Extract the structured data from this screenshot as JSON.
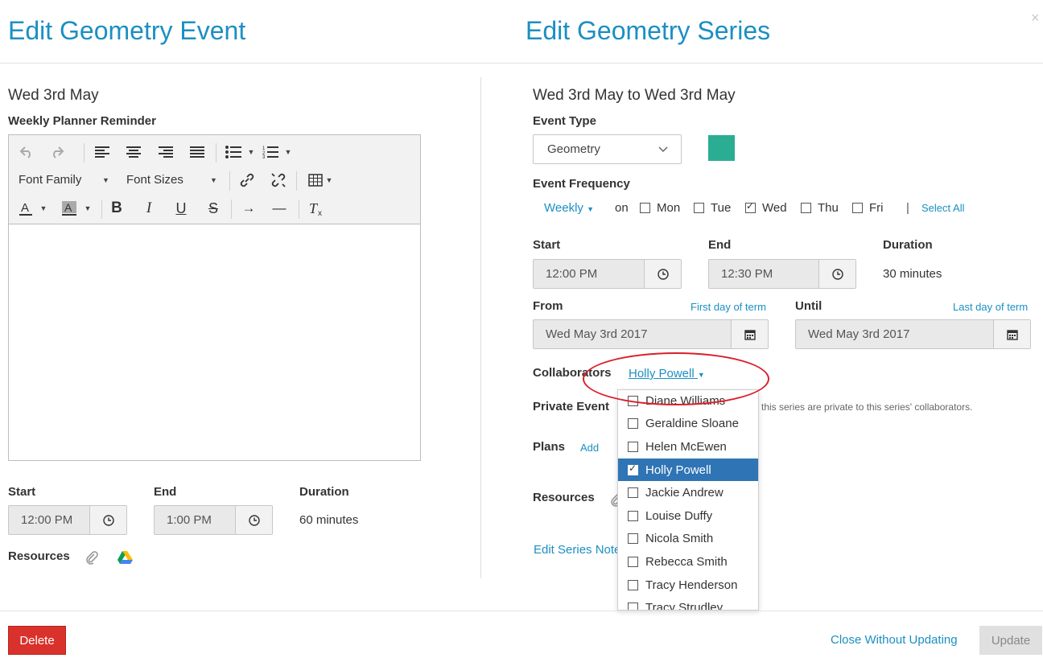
{
  "colors": {
    "accent": "#1b8fc2",
    "delete": "#d9312b",
    "event_type_swatch": "#2bad94",
    "selected_row": "#2f74b5",
    "annotation": "#d9202a"
  },
  "left": {
    "title": "Edit Geometry Event",
    "date": "Wed 3rd May",
    "reminder_label": "Weekly Planner Reminder",
    "toolbar": {
      "font_family": "Font Family",
      "font_sizes": "Font Sizes"
    },
    "start_label": "Start",
    "start_value": "12:00 PM",
    "end_label": "End",
    "end_value": "1:00 PM",
    "duration_label": "Duration",
    "duration_value": "60 minutes",
    "resources_label": "Resources"
  },
  "right": {
    "title": "Edit Geometry Series",
    "date_range": "Wed 3rd May to Wed 3rd May",
    "event_type_label": "Event Type",
    "event_type_value": "Geometry",
    "frequency_label": "Event Frequency",
    "frequency_value": "Weekly",
    "on_label": "on",
    "days": [
      {
        "label": "Mon",
        "checked": false
      },
      {
        "label": "Tue",
        "checked": false
      },
      {
        "label": "Wed",
        "checked": true
      },
      {
        "label": "Thu",
        "checked": false
      },
      {
        "label": "Fri",
        "checked": false
      }
    ],
    "select_all": "Select All",
    "start_label": "Start",
    "start_value": "12:00 PM",
    "end_label": "End",
    "end_value": "12:30 PM",
    "duration_label": "Duration",
    "duration_value": "30 minutes",
    "from_label": "From",
    "first_day_link": "First day of term",
    "from_value": "Wed May 3rd 2017",
    "until_label": "Until",
    "last_day_link": "Last day of term",
    "until_value": "Wed May 3rd 2017",
    "collaborators_label": "Collaborators",
    "collaborators_value": "Holly Powell",
    "private_label": "Private Event",
    "private_note": "this series are private to this series' collaborators.",
    "plans_label": "Plans",
    "plans_add": "Add",
    "resources_label": "Resources",
    "edit_notes": "Edit Series Notes"
  },
  "collaborator_options": [
    {
      "name": "Diane Williams",
      "checked": false
    },
    {
      "name": "Geraldine Sloane",
      "checked": false
    },
    {
      "name": "Helen McEwen",
      "checked": false
    },
    {
      "name": "Holly Powell",
      "checked": true
    },
    {
      "name": "Jackie Andrew",
      "checked": false
    },
    {
      "name": "Louise Duffy",
      "checked": false
    },
    {
      "name": "Nicola Smith",
      "checked": false
    },
    {
      "name": "Rebecca Smith",
      "checked": false
    },
    {
      "name": "Tracy Henderson",
      "checked": false
    },
    {
      "name": "Tracy Strudley",
      "checked": false
    }
  ],
  "footer": {
    "delete": "Delete",
    "close": "Close Without Updating",
    "update": "Update"
  },
  "close_glyph": "×"
}
